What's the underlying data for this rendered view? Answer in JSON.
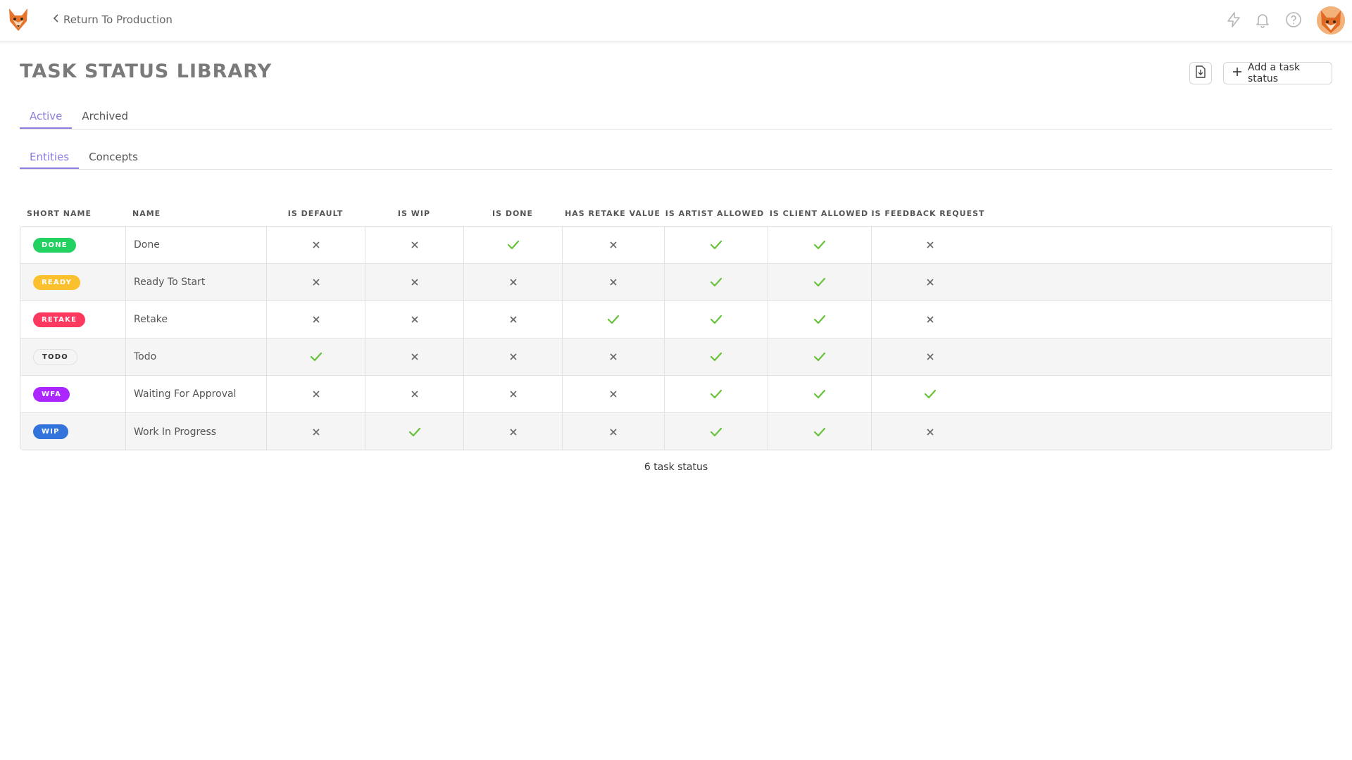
{
  "topbar": {
    "back_label": "Return To Production",
    "icons": [
      "lightning-icon",
      "bell-icon",
      "help-icon"
    ]
  },
  "page": {
    "title": "TASK STATUS LIBRARY",
    "add_label": "Add a task status"
  },
  "tabs": [
    {
      "label": "Active",
      "active": true
    },
    {
      "label": "Archived",
      "active": false
    }
  ],
  "subtabs": [
    {
      "label": "Entities",
      "active": true
    },
    {
      "label": "Concepts",
      "active": false
    }
  ],
  "table": {
    "columns": [
      "SHORT NAME",
      "NAME",
      "IS DEFAULT",
      "IS WIP",
      "IS DONE",
      "HAS RETAKE VALUE",
      "IS ARTIST ALLOWED",
      "IS CLIENT ALLOWED",
      "IS FEEDBACK REQUEST"
    ],
    "rows": [
      {
        "short": "DONE",
        "color": "#22d160",
        "text_color": "#ffffff",
        "name": "Done",
        "flags": [
          false,
          false,
          true,
          false,
          true,
          true,
          false
        ]
      },
      {
        "short": "READY",
        "color": "#fbc02d",
        "text_color": "#ffffff",
        "name": "Ready To Start",
        "flags": [
          false,
          false,
          false,
          false,
          true,
          true,
          false
        ]
      },
      {
        "short": "RETAKE",
        "color": "#ff3860",
        "text_color": "#ffffff",
        "name": "Retake",
        "flags": [
          false,
          false,
          false,
          true,
          true,
          true,
          false
        ]
      },
      {
        "short": "TODO",
        "color": "#f5f5f5",
        "text_color": "#333333",
        "name": "Todo",
        "flags": [
          true,
          false,
          false,
          false,
          true,
          true,
          false
        ]
      },
      {
        "short": "WFA",
        "color": "#ab26ff",
        "text_color": "#ffffff",
        "name": "Waiting For Approval",
        "flags": [
          false,
          false,
          false,
          false,
          true,
          true,
          true
        ]
      },
      {
        "short": "WIP",
        "color": "#3273dc",
        "text_color": "#ffffff",
        "name": "Work In Progress",
        "flags": [
          false,
          true,
          false,
          false,
          true,
          true,
          false
        ]
      }
    ]
  },
  "footer": {
    "count_label": "6 task status"
  },
  "colors": {
    "accent": "#8e7de0",
    "check": "#67c23a",
    "cross": "#666666"
  }
}
